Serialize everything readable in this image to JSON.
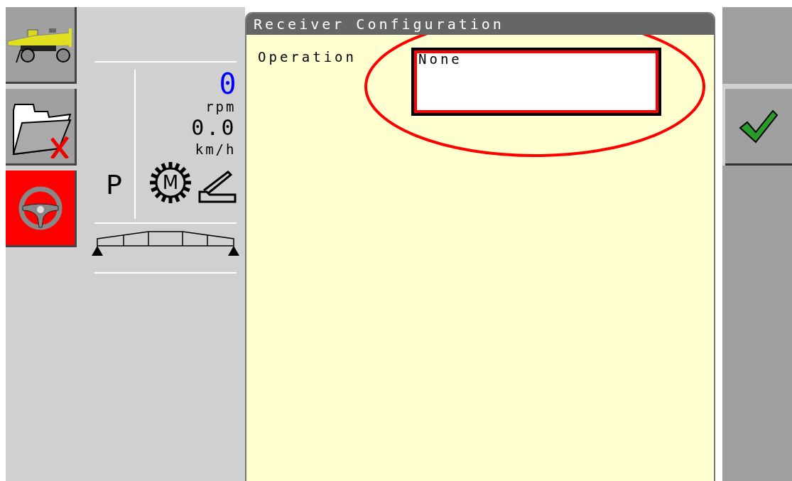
{
  "side_buttons": [
    {
      "kind": "vehicle",
      "active": false
    },
    {
      "kind": "folder",
      "active": false
    },
    {
      "kind": "steering",
      "active": true
    }
  ],
  "gauges": {
    "rpm": "0",
    "rpm_unit": "rpm",
    "speed": "0.0",
    "speed_unit": "km/h",
    "gear": "P",
    "engine_mode": "M"
  },
  "dialog": {
    "title": "Receiver Configuration",
    "fields": [
      {
        "label": "Operation",
        "value": "None",
        "focused": true,
        "circled": true
      }
    ]
  },
  "right_buttons": [
    {
      "kind": "blank"
    },
    {
      "kind": "confirm"
    }
  ]
}
